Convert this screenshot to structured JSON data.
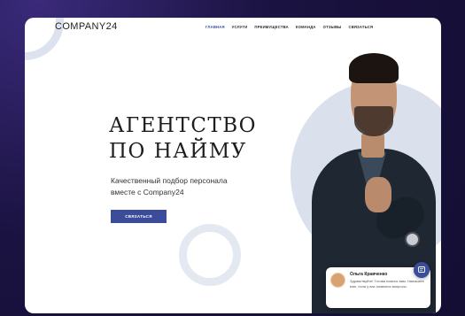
{
  "brand": {
    "logo_text": "COMPANY24"
  },
  "nav": {
    "items": [
      {
        "label": "ГЛАВНАЯ",
        "active": true
      },
      {
        "label": "УСЛУГИ"
      },
      {
        "label": "ПРЕИМУЩЕСТВА"
      },
      {
        "label": "КОМАНДА"
      },
      {
        "label": "ОТЗЫВЫ"
      },
      {
        "label": "СВЯЗАТЬСЯ"
      }
    ]
  },
  "hero": {
    "title_line1": "АГЕНТСТВО",
    "title_line2": "ПО НАЙМУ",
    "subtitle_line1": "Качественный подбор персонала",
    "subtitle_line2": "вместе с Company24",
    "cta_label": "СВЯЗАТЬСЯ"
  },
  "chat_widget": {
    "agent_name": "Ольга Кравченко",
    "message": "Здравствуйте! Готова помочь вам. Напишите мне, если у вас появятся вопросы.",
    "button_icon": "chat-icon"
  },
  "colors": {
    "accent": "#3a4c9a",
    "page_background": "#1a1240",
    "decor": "#dbe1ec"
  }
}
